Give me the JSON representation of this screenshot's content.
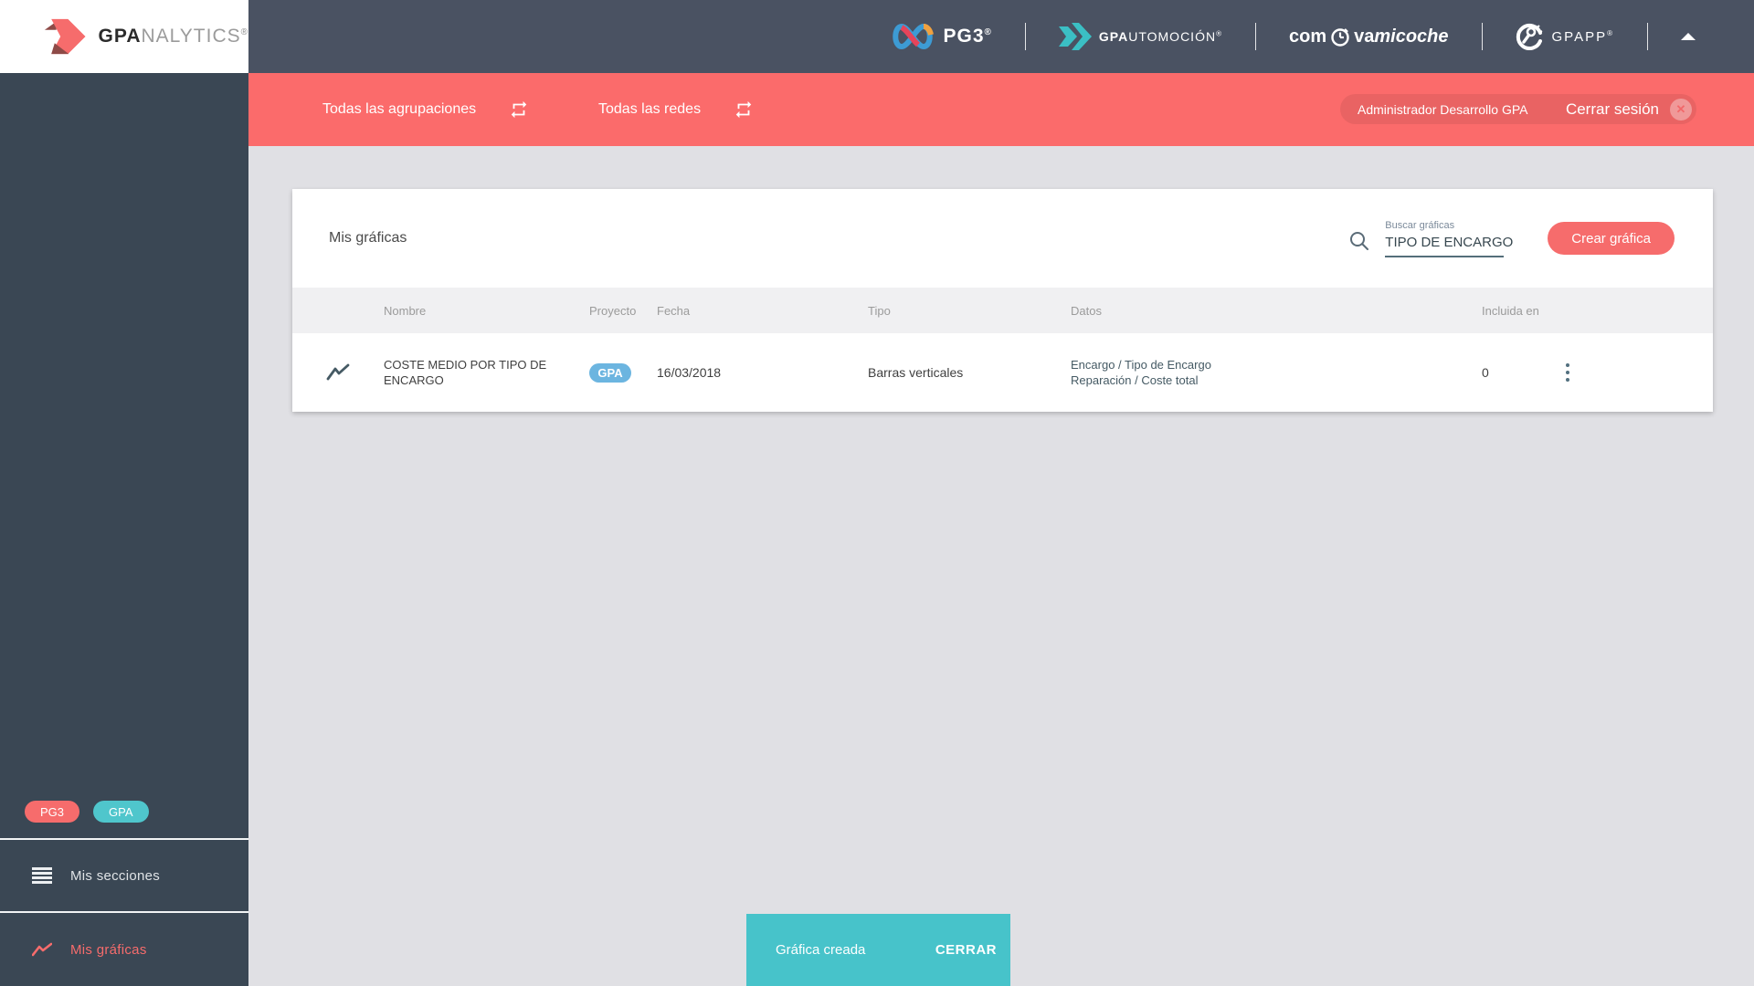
{
  "brand": {
    "analytics": {
      "bold": "GPA",
      "rest": "NALYTICS",
      "reg": "®"
    },
    "pg3": {
      "label": "PG3",
      "reg": "®"
    },
    "automocion": {
      "bold": "GPA",
      "rest": "UTOMOCIÓN",
      "reg": "®"
    },
    "comvamicoche": {
      "pre": "com",
      "mid": "va",
      "italic": "micoche"
    },
    "gpapp": {
      "label": "GPAPP",
      "reg": "®"
    }
  },
  "filter_bar": {
    "agrupaciones": "Todas las agrupaciones",
    "redes": "Todas las redes",
    "user": "Administrador Desarrollo GPA",
    "logout": "Cerrar sesión",
    "logout_x": "✕"
  },
  "card": {
    "title": "Mis gráficas",
    "search": {
      "label": "Buscar gráficas",
      "value": "TIPO DE ENCARGO"
    },
    "create_button": "Crear gráfica"
  },
  "table": {
    "headers": {
      "nombre": "Nombre",
      "proyecto": "Proyecto",
      "fecha": "Fecha",
      "tipo": "Tipo",
      "datos": "Datos",
      "incluida": "Incluida en"
    },
    "rows": [
      {
        "nombre": "COSTE MEDIO POR TIPO DE ENCARGO",
        "proyecto_badge": "GPA",
        "fecha": "16/03/2018",
        "tipo": "Barras verticales",
        "datos_line1": "Encargo / Tipo de Encargo",
        "datos_line2": "Reparación / Coste total",
        "incluida_en": "0"
      }
    ]
  },
  "sidebar": {
    "badges": [
      {
        "label": "PG3",
        "color": "#f66c6c"
      },
      {
        "label": "GPA",
        "color": "#4fc6cc"
      }
    ],
    "items": [
      {
        "label": "Mis secciones"
      },
      {
        "label": "Mis gráficas"
      }
    ]
  },
  "toast": {
    "message": "Gráfica creada",
    "action": "CERRAR"
  },
  "colors": {
    "header": "#4a5262",
    "sidebar": "#3a4754",
    "accent_red": "#fb6b6b",
    "button_red": "#f66c6c",
    "toast_teal": "#47c3ca",
    "badge_blue": "#6cb5e0",
    "page_bg": "#e0e0e4"
  }
}
